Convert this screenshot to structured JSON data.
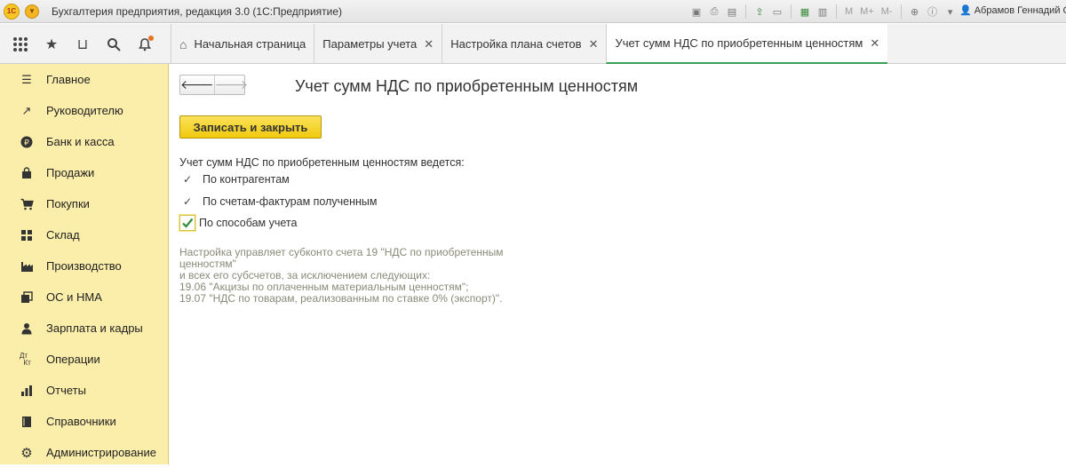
{
  "window": {
    "title": "Бухгалтерия предприятия, редакция 3.0  (1С:Предприятие)",
    "logo_text": "1С",
    "toolbar_m_labels": [
      "M",
      "M+",
      "M-"
    ],
    "user": "Абрамов Геннадий Се"
  },
  "tabs": [
    {
      "label": "Начальная страница",
      "closable": false,
      "active": false
    },
    {
      "label": "Параметры учета",
      "closable": true,
      "active": false
    },
    {
      "label": "Настройка плана счетов",
      "closable": true,
      "active": false
    },
    {
      "label": "Учет сумм НДС по приобретенным ценностям",
      "closable": true,
      "active": true
    }
  ],
  "sidebar": {
    "items": [
      {
        "label": "Главное",
        "icon": "menu-icon"
      },
      {
        "label": "Руководителю",
        "icon": "trend-icon"
      },
      {
        "label": "Банк и касса",
        "icon": "ruble-icon"
      },
      {
        "label": "Продажи",
        "icon": "bag-icon"
      },
      {
        "label": "Покупки",
        "icon": "cart-icon"
      },
      {
        "label": "Склад",
        "icon": "warehouse-icon"
      },
      {
        "label": "Производство",
        "icon": "factory-icon"
      },
      {
        "label": "ОС и НМА",
        "icon": "assets-icon"
      },
      {
        "label": "Зарплата и кадры",
        "icon": "person-icon"
      },
      {
        "label": "Операции",
        "icon": "dt-kt-icon"
      },
      {
        "label": "Отчеты",
        "icon": "report-icon"
      },
      {
        "label": "Справочники",
        "icon": "book-icon"
      },
      {
        "label": "Администрирование",
        "icon": "gear-icon"
      }
    ]
  },
  "main": {
    "title": "Учет сумм НДС по приобретенным ценностям",
    "save_button": "Записать и закрыть",
    "lead": "Учет сумм НДС по приобретенным ценностям ведется:",
    "options": [
      "По контрагентам",
      "По счетам-фактурам полученным"
    ],
    "checkbox": {
      "label": "По способам учета",
      "checked": true
    },
    "note": "Настройка управляет субконто счета 19 \"НДС по приобретенным\nценностям\"\nи всех его субсчетов, за исключением следующих:\n19.06 \"Акцизы по оплаченным материальным ценностям\";\n19.07 \"НДС по товарам, реализованным по ставке 0% (экспорт)\"."
  },
  "colors": {
    "sidebar_bg": "#fbedaa",
    "save_button_bg": "#f4d21f",
    "active_tab_underline": "#3aa05a",
    "note_text": "#8a8a7a"
  }
}
